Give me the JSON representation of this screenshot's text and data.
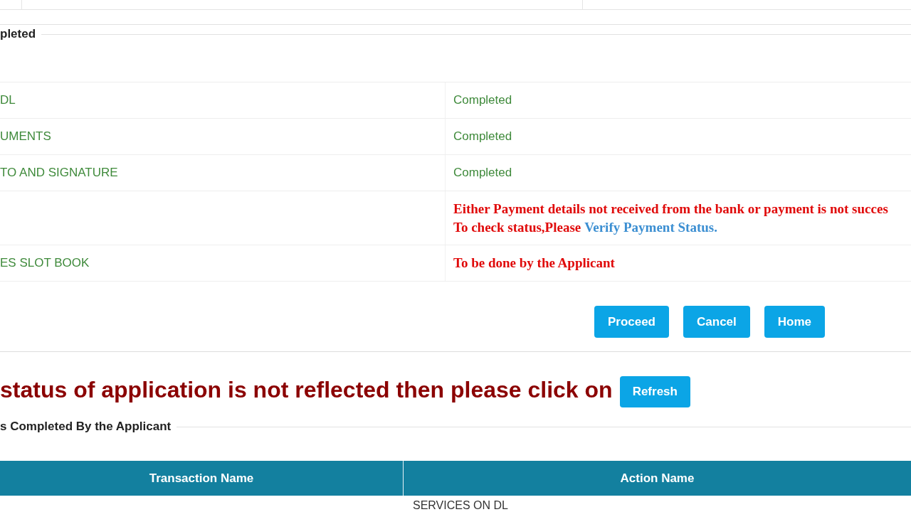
{
  "section_1": {
    "legend": "pleted",
    "rows": [
      {
        "task": "DL",
        "kind": "done",
        "status": "Completed"
      },
      {
        "task": "UMENTS",
        "kind": "done",
        "status": "Completed"
      },
      {
        "task": "TO AND SIGNATURE",
        "kind": "done",
        "status": "Completed"
      },
      {
        "kind": "pending",
        "status": "Either Payment details not received from the bank or payment is not succes",
        "note": "To check status,Please",
        "link": "Verify Payment Status."
      },
      {
        "task": "ES SLOT BOOK",
        "kind": "pending",
        "status": "To be done by the Applicant"
      }
    ]
  },
  "actions": [
    "Proceed",
    "Cancel",
    "Home"
  ],
  "notice": {
    "text": "status of application is not reflected then please click on",
    "button": "Refresh"
  },
  "section_2": {
    "legend": "s Completed By the Applicant",
    "table": {
      "columns": [
        "Transaction Name",
        "Action Name"
      ],
      "rows": [
        {
          "action": "SERVICES ON DL"
        }
      ]
    }
  }
}
